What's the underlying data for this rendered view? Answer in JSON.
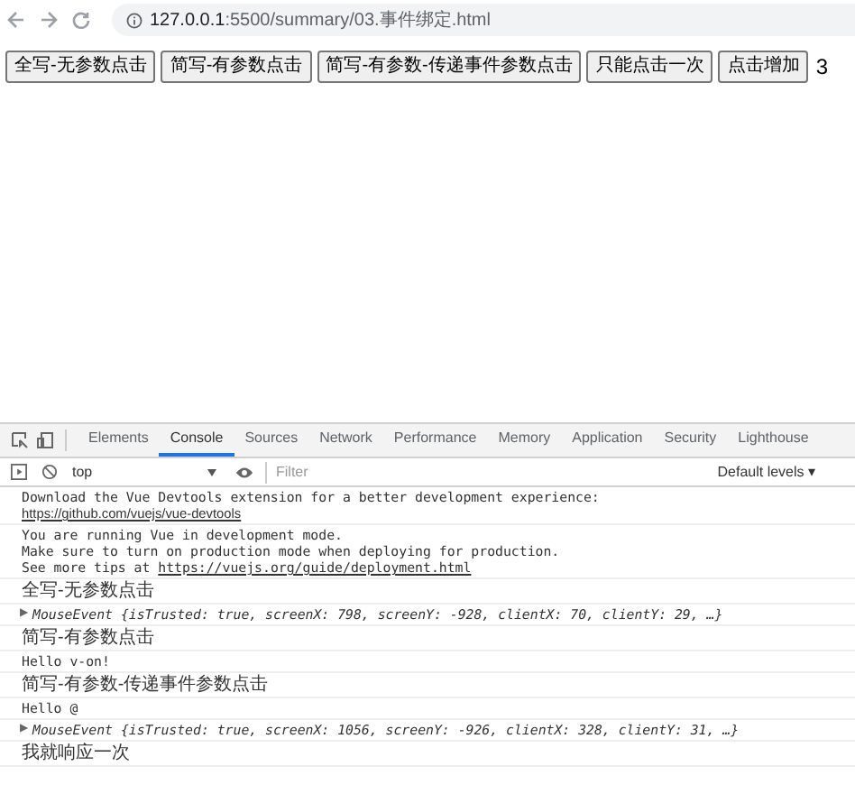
{
  "address_bar": {
    "host": "127.0.0.1",
    "path": ":5500/summary/03.事件绑定.html"
  },
  "page": {
    "buttons": [
      "全写-无参数点击",
      "简写-有参数点击",
      "简写-有参数-传递事件参数点击",
      "只能点击一次",
      "点击增加"
    ],
    "counter": "3"
  },
  "devtools": {
    "tabs": [
      {
        "label": "Elements",
        "selected": false
      },
      {
        "label": "Console",
        "selected": true
      },
      {
        "label": "Sources",
        "selected": false
      },
      {
        "label": "Network",
        "selected": false
      },
      {
        "label": "Performance",
        "selected": false
      },
      {
        "label": "Memory",
        "selected": false
      },
      {
        "label": "Application",
        "selected": false
      },
      {
        "label": "Security",
        "selected": false
      },
      {
        "label": "Lighthouse",
        "selected": false
      }
    ],
    "context": "top",
    "filter_placeholder": "Filter",
    "levels": "Default levels ▾",
    "messages": [
      {
        "kind": "text",
        "lines": [
          {
            "text": "Download the Vue Devtools extension for a better development experience:"
          },
          {
            "link": "https://github.com/vuejs/vue-devtools"
          }
        ]
      },
      {
        "kind": "text",
        "lines": [
          {
            "text": "You are running Vue in development mode."
          },
          {
            "text": "Make sure to turn on production mode when deploying for production."
          },
          {
            "text": "See more tips at ",
            "link": "https://vuejs.org/guide/deployment.html"
          }
        ]
      },
      {
        "kind": "cjk",
        "text": "全写-无参数点击"
      },
      {
        "kind": "object",
        "toggle": "▶",
        "text": "MouseEvent {isTrusted: true, screenX: 798, screenY: -928, clientX: 70, clientY: 29, …}"
      },
      {
        "kind": "cjk",
        "text": "简写-有参数点击"
      },
      {
        "kind": "text",
        "lines": [
          {
            "text": "Hello v-on!"
          }
        ]
      },
      {
        "kind": "cjk",
        "text": "简写-有参数-传递事件参数点击"
      },
      {
        "kind": "text",
        "lines": [
          {
            "text": "Hello @"
          }
        ]
      },
      {
        "kind": "object",
        "toggle": "▶",
        "text": "MouseEvent {isTrusted: true, screenX: 1056, screenY: -926, clientX: 328, clientY: 31, …}"
      },
      {
        "kind": "cjk",
        "text": "我就响应一次"
      }
    ]
  }
}
